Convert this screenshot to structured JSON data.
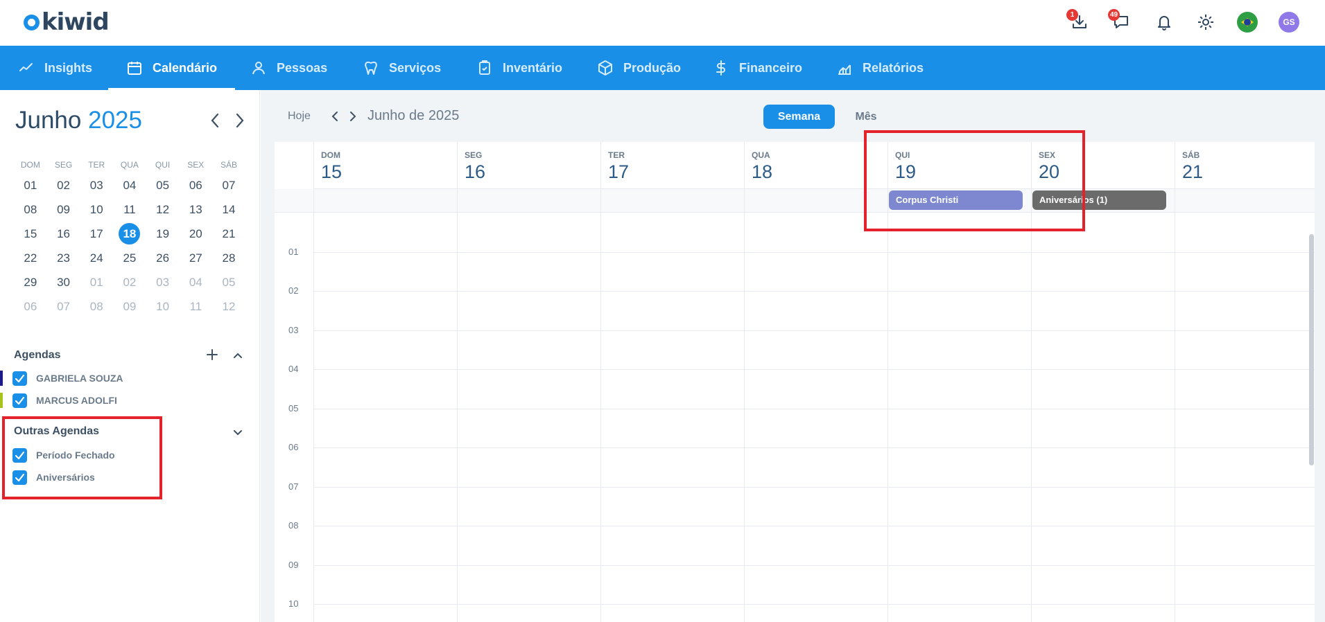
{
  "brand": {
    "logo_text": "kiwid"
  },
  "top_icons": {
    "downloads_badge": "1",
    "messages_badge": "49",
    "avatar_initials": "GS",
    "names": [
      "download-icon",
      "chat-icon",
      "bell-icon",
      "gear-icon",
      "brazil-flag-icon",
      "avatar"
    ]
  },
  "nav": {
    "items": [
      {
        "label": "Insights",
        "icon": "chart-line-icon"
      },
      {
        "label": "Calendário",
        "icon": "calendar-icon",
        "active": true
      },
      {
        "label": "Pessoas",
        "icon": "person-icon"
      },
      {
        "label": "Serviços",
        "icon": "tooth-icon"
      },
      {
        "label": "Inventário",
        "icon": "clipboard-check-icon"
      },
      {
        "label": "Produção",
        "icon": "box-icon"
      },
      {
        "label": "Financeiro",
        "icon": "dollar-icon"
      },
      {
        "label": "Relatórios",
        "icon": "report-chart-icon"
      }
    ]
  },
  "mini_calendar": {
    "month": "Junho",
    "year": "2025",
    "weekdays": [
      "DOM",
      "SEG",
      "TER",
      "QUA",
      "QUI",
      "SEX",
      "SÁB"
    ],
    "days": [
      [
        "01",
        "02",
        "03",
        "04",
        "05",
        "06",
        "07"
      ],
      [
        "08",
        "09",
        "10",
        "11",
        "12",
        "13",
        "14"
      ],
      [
        "15",
        "16",
        "17",
        "18",
        "19",
        "20",
        "21"
      ],
      [
        "22",
        "23",
        "24",
        "25",
        "26",
        "27",
        "28"
      ],
      [
        "29",
        "30",
        "01",
        "02",
        "03",
        "04",
        "05"
      ],
      [
        "06",
        "07",
        "08",
        "09",
        "10",
        "11",
        "12"
      ]
    ],
    "today": "18"
  },
  "agendas": {
    "title": "Agendas",
    "items": [
      {
        "label": "GABRIELA SOUZA",
        "color": "#1d1a8a",
        "checked": true
      },
      {
        "label": "MARCUS ADOLFI",
        "color": "#a6c21b",
        "checked": true
      }
    ]
  },
  "other_agendas": {
    "title": "Outras Agendas",
    "items": [
      {
        "label": "Período Fechado",
        "checked": true
      },
      {
        "label": "Aniversários",
        "checked": true
      }
    ]
  },
  "toolbar": {
    "today_label": "Hoje",
    "title": "Junho de 2025",
    "week_label": "Semana",
    "month_label": "Mês"
  },
  "week": {
    "days": [
      {
        "weekday": "DOM",
        "date": "15"
      },
      {
        "weekday": "SEG",
        "date": "16"
      },
      {
        "weekday": "TER",
        "date": "17"
      },
      {
        "weekday": "QUA",
        "date": "18"
      },
      {
        "weekday": "QUI",
        "date": "19"
      },
      {
        "weekday": "SEX",
        "date": "20"
      },
      {
        "weekday": "SÁB",
        "date": "21"
      }
    ],
    "events": [
      {
        "title": "Corpus Christi",
        "day": "QUI",
        "color": "#7d88d0"
      },
      {
        "title": "Aniversários (1)",
        "day": "SEX",
        "color": "#6b6b6b"
      }
    ],
    "hours": [
      "01",
      "02",
      "03",
      "04",
      "05",
      "06",
      "07",
      "08",
      "09",
      "10"
    ]
  },
  "colors": {
    "primary": "#1a8fe8",
    "highlight": "#e3222b"
  }
}
